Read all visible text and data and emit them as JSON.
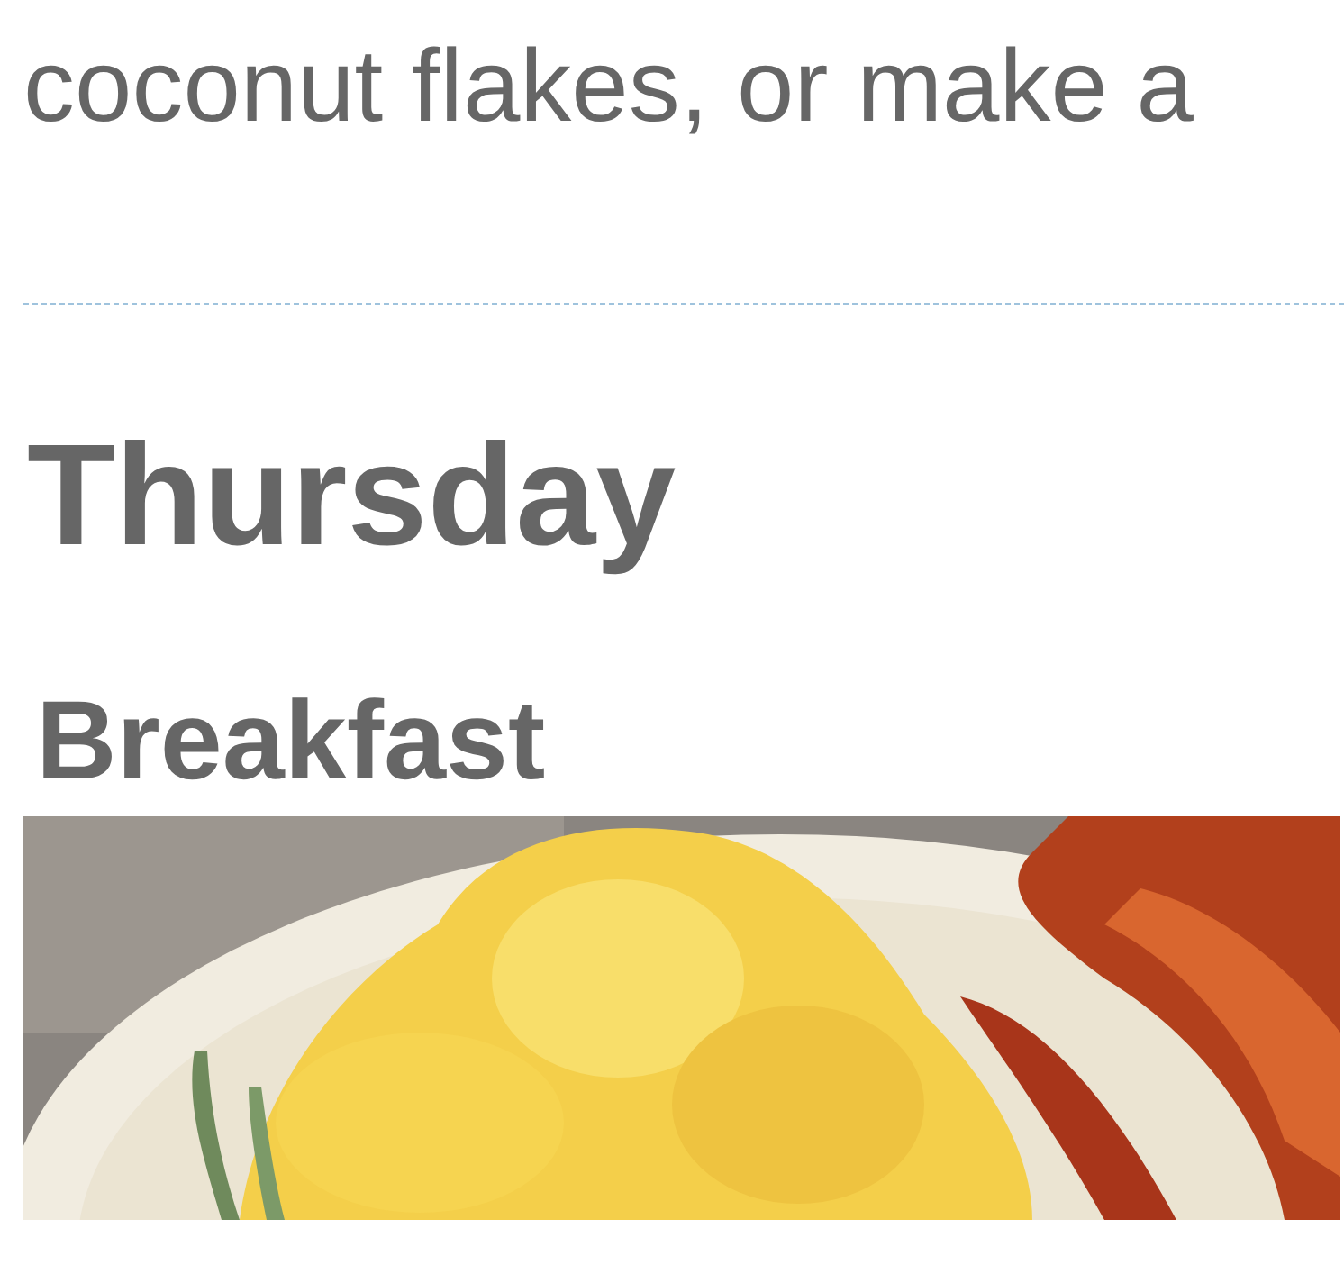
{
  "paragraph": "coconut flakes, or make a",
  "day": "Thursday",
  "meal": {
    "title": "Breakfast"
  }
}
